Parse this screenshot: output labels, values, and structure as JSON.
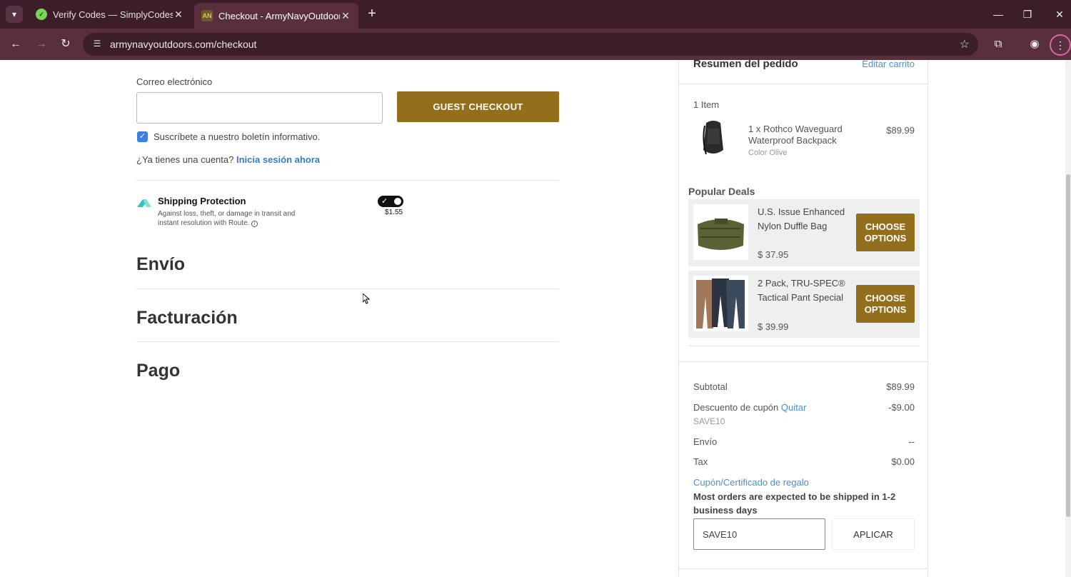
{
  "browser": {
    "tabs": [
      {
        "title": "Verify Codes — SimplyCodes",
        "favicon": "simplycodes-icon"
      },
      {
        "title": "Checkout - ArmyNavyOutdoors",
        "favicon": "armynavy-icon",
        "favicon_text": "AN",
        "active": true
      }
    ],
    "url": "armynavyoutdoors.com/checkout"
  },
  "checkout": {
    "email_label": "Correo electrónico",
    "email_value": "",
    "guest_button": "GUEST CHECKOUT",
    "newsletter_label": "Suscríbete a nuestro boletín informativo.",
    "newsletter_checked": true,
    "account_question": "¿Ya tienes una cuenta?",
    "login_link": "Inicia sesión ahora",
    "shipping_protection": {
      "title": "Shipping Protection",
      "description": "Against loss, theft, or damage in transit and instant resolution with Route.",
      "price": "$1.55",
      "enabled": true
    },
    "sections": [
      "Envío",
      "Facturación",
      "Pago"
    ]
  },
  "summary": {
    "title": "Resumen del pedido",
    "edit_link": "Editar carrito",
    "item_count": "1 Item",
    "item": {
      "name": "1 x Rothco Waveguard Waterproof Backpack",
      "variant": "Color Olive",
      "price": "$89.99"
    },
    "deals_title": "Popular Deals",
    "deals": [
      {
        "name": "U.S. Issue Enhanced Nylon Duffle Bag",
        "price": "$ 37.95",
        "button": "CHOOSE OPTIONS"
      },
      {
        "name": "2 Pack, TRU-SPEC® Tactical Pant Special",
        "price": "$ 39.99",
        "button": "CHOOSE OPTIONS"
      }
    ],
    "subtotal_label": "Subtotal",
    "subtotal_value": "$89.99",
    "discount_label": "Descuento de cupón",
    "discount_remove": "Quitar",
    "discount_value": "-$9.00",
    "discount_code": "SAVE10",
    "shipping_label": "Envío",
    "shipping_value": "--",
    "tax_label": "Tax",
    "tax_value": "$0.00",
    "gift_link": "Cupón/Certificado de regalo",
    "ship_note": "Most orders are expected to be shipped in 1-2 business days",
    "coupon_value": "SAVE10",
    "apply_button": "APLICAR"
  }
}
